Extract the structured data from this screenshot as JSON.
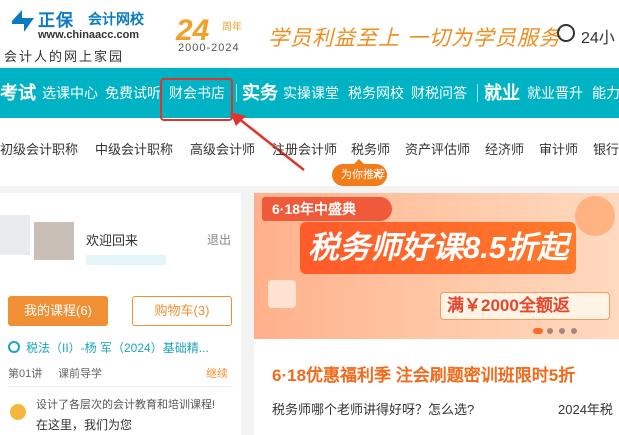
{
  "header": {
    "brand_name": "正保",
    "brand_sub": "会计网校",
    "brand_url": "www.chinaacc.com",
    "brand_tagline": "会计人的网上家园",
    "anniversary_number": "24",
    "anniversary_unit": "周年",
    "anniversary_years": "2000-2024",
    "slogan": "学员利益至上  一切为学员服务",
    "hotline_text": "24小"
  },
  "nav": {
    "heads": [
      "考试",
      "实务",
      "就业"
    ],
    "exam_items": [
      "选课中心",
      "免费试听",
      "财会书店"
    ],
    "practice_items": [
      "实操课堂",
      "税务网校",
      "财税问答"
    ],
    "job_items": [
      "就业晋升",
      "能力"
    ]
  },
  "subnav": {
    "items": [
      "初级会计职称",
      "中级会计职称",
      "高级会计师",
      "注册会计师",
      "税务师",
      "资产评估师",
      "经济师",
      "审计师",
      "银行"
    ],
    "recommend_badge": "为你推荐",
    "recommend_close": "✕"
  },
  "user_panel": {
    "welcome": "欢迎回来",
    "logout": "退出",
    "my_courses_button": "我的课程(6)",
    "cart_button": "购物车(3)",
    "course_title": "税法（II）-杨    军（2024）基础精...",
    "lesson_no": "第01讲",
    "lesson_name": "课前导学",
    "continue_label": "继续",
    "assistant_line1": "设计了各层次的会计教育和培训课程!",
    "assistant_line2": "在这里，我们为您"
  },
  "banner": {
    "tag": "6·18年中盛典",
    "title": "税务师好课8.5折起",
    "subtitle": "满￥2000全额返",
    "dots": 4,
    "active_dot": 0
  },
  "promo": {
    "title": "6·18优惠福利季  注会刷题密训班限时5折",
    "question": "税务师哪个老师讲得好呀？怎么选?",
    "question2": "2024年税"
  },
  "colors": {
    "nav_bg": "#00b3c4",
    "accent_orange": "#f08f34",
    "highlight_red": "#e0332b",
    "brand_blue": "#0b7bbf"
  }
}
